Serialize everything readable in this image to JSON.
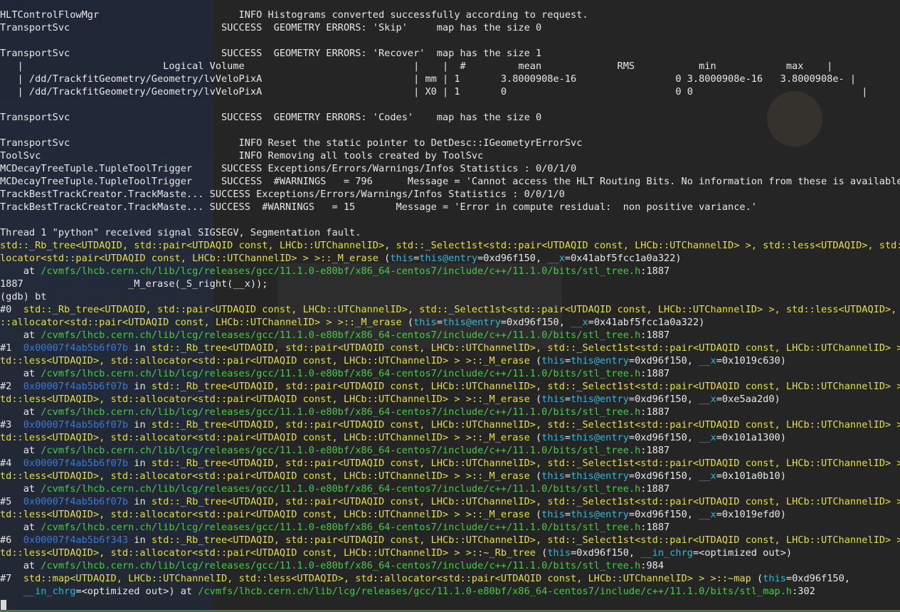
{
  "terminal": {
    "lines": [
      [
        {
          "t": "HLTControlFlowMgr                        INFO Histograms converted successfully according to request."
        }
      ],
      [
        {
          "t": "TransportSvc                          SUCCESS  GEOMETRY ERRORS: 'Skip'     map has the size 0"
        }
      ],
      [
        {
          "t": ""
        }
      ],
      [
        {
          "t": "TransportSvc                          SUCCESS  GEOMETRY ERRORS: 'Recover'  map has the size 1"
        }
      ],
      [
        {
          "t": "   |                        Logical Volume                             |    |  #         mean             RMS           min            max    |"
        }
      ],
      [
        {
          "t": "   | /dd/TrackfitGeometry/Geometry/lvVeloPixA                          | mm | 1       3.8000908e-16                 0 3.8000908e-16   3.8000908e- |"
        }
      ],
      [
        {
          "t": "   | /dd/TrackfitGeometry/Geometry/lvVeloPixA                          | X0 | 1       0                             0 0                             |"
        }
      ],
      [
        {
          "t": ""
        }
      ],
      [
        {
          "t": "TransportSvc                          SUCCESS  GEOMETRY ERRORS: 'Codes'    map has the size 0"
        }
      ],
      [
        {
          "t": ""
        }
      ],
      [
        {
          "t": "TransportSvc                             INFO Reset the static pointer to DetDesc::IGeometyrErrorSvc"
        }
      ],
      [
        {
          "t": "ToolSvc                                  INFO Removing all tools created by ToolSvc"
        }
      ],
      [
        {
          "t": "MCDecayTreeTuple.TupleToolTrigger     SUCCESS Exceptions/Errors/Warnings/Infos Statistics : 0/0/1/0"
        }
      ],
      [
        {
          "t": "MCDecayTreeTuple.TupleToolTrigger     SUCCESS  #WARNINGS   = 796      Message = 'Cannot access the HLT Routing Bits. No information from these is available'"
        }
      ],
      [
        {
          "t": "TrackBestTrackCreator.TrackMaste... SUCCESS Exceptions/Errors/Warnings/Infos Statistics : 0/0/1/0"
        }
      ],
      [
        {
          "t": "TrackBestTrackCreator.TrackMaste... SUCCESS  #WARNINGS   = 15       Message = 'Error in compute residual:  non positive variance.'"
        }
      ],
      [
        {
          "t": ""
        }
      ],
      [
        {
          "t": "Thread 1 \"python\" received signal SIGSEGV, Segmentation fault."
        }
      ],
      [
        {
          "t": "std::_Rb_tree<UTDAQID, std::pair<UTDAQID const, LHCb::UTChannelID>, std::_Select1st<std::pair<UTDAQID const, LHCb::UTChannelID> >, std::less<UTDAQID>, std::al",
          "c": "y"
        }
      ],
      [
        {
          "t": "locator<std::pair<UTDAQID const, LHCb::UTChannelID> > >::_M_erase",
          "c": "y"
        },
        {
          "t": " ("
        },
        {
          "t": "this",
          "c": "c"
        },
        {
          "t": "="
        },
        {
          "t": "this@entry",
          "c": "c"
        },
        {
          "t": "=0xd96f150, "
        },
        {
          "t": "__x",
          "c": "c"
        },
        {
          "t": "=0x41abf5fcc1a0a322)"
        }
      ],
      [
        {
          "t": "    at "
        },
        {
          "t": "/cvmfs/lhcb.cern.ch/lib/lcg/releases/gcc/11.1.0-e80bf/x86_64-centos7/include/c++/11.1.0/bits/stl_tree.h",
          "c": "g"
        },
        {
          "t": ":1887"
        }
      ],
      [
        {
          "t": "1887                  _M_erase(_S_right(__x));"
        }
      ],
      [
        {
          "t": "(gdb) bt"
        }
      ],
      [
        {
          "t": "#0  "
        },
        {
          "t": "std::_Rb_tree<UTDAQID, std::pair<UTDAQID const, LHCb::UTChannelID>, std::_Select1st<std::pair<UTDAQID const, LHCb::UTChannelID> >, std::less<UTDAQID>, std",
          "c": "y"
        }
      ],
      [
        {
          "t": "::allocator<std::pair<UTDAQID const, LHCb::UTChannelID> > >::_M_erase",
          "c": "y"
        },
        {
          "t": " ("
        },
        {
          "t": "this",
          "c": "c"
        },
        {
          "t": "="
        },
        {
          "t": "this@entry",
          "c": "c"
        },
        {
          "t": "=0xd96f150, "
        },
        {
          "t": "__x",
          "c": "c"
        },
        {
          "t": "=0x41abf5fcc1a0a322)"
        }
      ],
      [
        {
          "t": "    at "
        },
        {
          "t": "/cvmfs/lhcb.cern.ch/lib/lcg/releases/gcc/11.1.0-e80bf/x86_64-centos7/include/c++/11.1.0/bits/stl_tree.h",
          "c": "g"
        },
        {
          "t": ":1887"
        }
      ],
      [
        {
          "t": "#1  "
        },
        {
          "t": "0x00007f4ab5b6f07b",
          "c": "b"
        },
        {
          "t": " in "
        },
        {
          "t": "std::_Rb_tree<UTDAQID, std::pair<UTDAQID const, LHCb::UTChannelID>, std::_Select1st<std::pair<UTDAQID const, LHCb::UTChannelID> >, s",
          "c": "y"
        }
      ],
      [
        {
          "t": "td::less<UTDAQID>, std::allocator<std::pair<UTDAQID const, LHCb::UTChannelID> > >::_M_erase",
          "c": "y"
        },
        {
          "t": " ("
        },
        {
          "t": "this",
          "c": "c"
        },
        {
          "t": "="
        },
        {
          "t": "this@entry",
          "c": "c"
        },
        {
          "t": "=0xd96f150, "
        },
        {
          "t": "__x",
          "c": "c"
        },
        {
          "t": "=0x1019c630)"
        }
      ],
      [
        {
          "t": "    at "
        },
        {
          "t": "/cvmfs/lhcb.cern.ch/lib/lcg/releases/gcc/11.1.0-e80bf/x86_64-centos7/include/c++/11.1.0/bits/stl_tree.h",
          "c": "g"
        },
        {
          "t": ":1887"
        }
      ],
      [
        {
          "t": "#2  "
        },
        {
          "t": "0x00007f4ab5b6f07b",
          "c": "b"
        },
        {
          "t": " in "
        },
        {
          "t": "std::_Rb_tree<UTDAQID, std::pair<UTDAQID const, LHCb::UTChannelID>, std::_Select1st<std::pair<UTDAQID const, LHCb::UTChannelID> >, s",
          "c": "y"
        }
      ],
      [
        {
          "t": "td::less<UTDAQID>, std::allocator<std::pair<UTDAQID const, LHCb::UTChannelID> > >::_M_erase",
          "c": "y"
        },
        {
          "t": " ("
        },
        {
          "t": "this",
          "c": "c"
        },
        {
          "t": "="
        },
        {
          "t": "this@entry",
          "c": "c"
        },
        {
          "t": "=0xd96f150, "
        },
        {
          "t": "__x",
          "c": "c"
        },
        {
          "t": "=0xe5aa2d0)"
        }
      ],
      [
        {
          "t": "    at "
        },
        {
          "t": "/cvmfs/lhcb.cern.ch/lib/lcg/releases/gcc/11.1.0-e80bf/x86_64-centos7/include/c++/11.1.0/bits/stl_tree.h",
          "c": "g"
        },
        {
          "t": ":1887"
        }
      ],
      [
        {
          "t": "#3  "
        },
        {
          "t": "0x00007f4ab5b6f07b",
          "c": "b"
        },
        {
          "t": " in "
        },
        {
          "t": "std::_Rb_tree<UTDAQID, std::pair<UTDAQID const, LHCb::UTChannelID>, std::_Select1st<std::pair<UTDAQID const, LHCb::UTChannelID> >, s",
          "c": "y"
        }
      ],
      [
        {
          "t": "td::less<UTDAQID>, std::allocator<std::pair<UTDAQID const, LHCb::UTChannelID> > >::_M_erase",
          "c": "y"
        },
        {
          "t": " ("
        },
        {
          "t": "this",
          "c": "c"
        },
        {
          "t": "="
        },
        {
          "t": "this@entry",
          "c": "c"
        },
        {
          "t": "=0xd96f150, "
        },
        {
          "t": "__x",
          "c": "c"
        },
        {
          "t": "=0x101a1300)"
        }
      ],
      [
        {
          "t": "    at "
        },
        {
          "t": "/cvmfs/lhcb.cern.ch/lib/lcg/releases/gcc/11.1.0-e80bf/x86_64-centos7/include/c++/11.1.0/bits/stl_tree.h",
          "c": "g"
        },
        {
          "t": ":1887"
        }
      ],
      [
        {
          "t": "#4  "
        },
        {
          "t": "0x00007f4ab5b6f07b",
          "c": "b"
        },
        {
          "t": " in "
        },
        {
          "t": "std::_Rb_tree<UTDAQID, std::pair<UTDAQID const, LHCb::UTChannelID>, std::_Select1st<std::pair<UTDAQID const, LHCb::UTChannelID> >, s",
          "c": "y"
        }
      ],
      [
        {
          "t": "td::less<UTDAQID>, std::allocator<std::pair<UTDAQID const, LHCb::UTChannelID> > >::_M_erase",
          "c": "y"
        },
        {
          "t": " ("
        },
        {
          "t": "this",
          "c": "c"
        },
        {
          "t": "="
        },
        {
          "t": "this@entry",
          "c": "c"
        },
        {
          "t": "=0xd96f150, "
        },
        {
          "t": "__x",
          "c": "c"
        },
        {
          "t": "=0x101a0b10)"
        }
      ],
      [
        {
          "t": "    at "
        },
        {
          "t": "/cvmfs/lhcb.cern.ch/lib/lcg/releases/gcc/11.1.0-e80bf/x86_64-centos7/include/c++/11.1.0/bits/stl_tree.h",
          "c": "g"
        },
        {
          "t": ":1887"
        }
      ],
      [
        {
          "t": "#5  "
        },
        {
          "t": "0x00007f4ab5b6f07b",
          "c": "b"
        },
        {
          "t": " in "
        },
        {
          "t": "std::_Rb_tree<UTDAQID, std::pair<UTDAQID const, LHCb::UTChannelID>, std::_Select1st<std::pair<UTDAQID const, LHCb::UTChannelID> >, s",
          "c": "y"
        }
      ],
      [
        {
          "t": "td::less<UTDAQID>, std::allocator<std::pair<UTDAQID const, LHCb::UTChannelID> > >::_M_erase",
          "c": "y"
        },
        {
          "t": " ("
        },
        {
          "t": "this",
          "c": "c"
        },
        {
          "t": "="
        },
        {
          "t": "this@entry",
          "c": "c"
        },
        {
          "t": "=0xd96f150, "
        },
        {
          "t": "__x",
          "c": "c"
        },
        {
          "t": "=0x1019efd0)"
        }
      ],
      [
        {
          "t": "    at "
        },
        {
          "t": "/cvmfs/lhcb.cern.ch/lib/lcg/releases/gcc/11.1.0-e80bf/x86_64-centos7/include/c++/11.1.0/bits/stl_tree.h",
          "c": "g"
        },
        {
          "t": ":1887"
        }
      ],
      [
        {
          "t": "#6  "
        },
        {
          "t": "0x00007f4ab5b6f343",
          "c": "b"
        },
        {
          "t": " in "
        },
        {
          "t": "std::_Rb_tree<UTDAQID, std::pair<UTDAQID const, LHCb::UTChannelID>, std::_Select1st<std::pair<UTDAQID const, LHCb::UTChannelID> >, s",
          "c": "y"
        }
      ],
      [
        {
          "t": "td::less<UTDAQID>, std::allocator<std::pair<UTDAQID const, LHCb::UTChannelID> > >::~_Rb_tree",
          "c": "y"
        },
        {
          "t": " ("
        },
        {
          "t": "this",
          "c": "c"
        },
        {
          "t": "=0xd96f150, "
        },
        {
          "t": "__in_chrg",
          "c": "c"
        },
        {
          "t": "=<optimized out>)"
        }
      ],
      [
        {
          "t": "    at "
        },
        {
          "t": "/cvmfs/lhcb.cern.ch/lib/lcg/releases/gcc/11.1.0-e80bf/x86_64-centos7/include/c++/11.1.0/bits/stl_tree.h",
          "c": "g"
        },
        {
          "t": ":984"
        }
      ],
      [
        {
          "t": "#7  "
        },
        {
          "t": "std::map<UTDAQID, LHCb::UTChannelID, std::less<UTDAQID>, std::allocator<std::pair<UTDAQID const, LHCb::UTChannelID> > >::~map",
          "c": "y"
        },
        {
          "t": " ("
        },
        {
          "t": "this",
          "c": "c"
        },
        {
          "t": "=0xd96f150,"
        }
      ],
      [
        {
          "t": "    "
        },
        {
          "t": "__in_chrg",
          "c": "c"
        },
        {
          "t": "=<optimized out>) at "
        },
        {
          "t": "/cvmfs/lhcb.cern.ch/lib/lcg/releases/gcc/11.1.0-e80bf/x86_64-centos7/include/c++/11.1.0/bits/stl_map.h",
          "c": "g"
        },
        {
          "t": ":302"
        }
      ]
    ]
  },
  "colors": {
    "text": "#e8e8e8",
    "function": "#e6de4a",
    "path": "#4cc84c",
    "address": "#3b78d8",
    "argument": "#37b5d6"
  }
}
